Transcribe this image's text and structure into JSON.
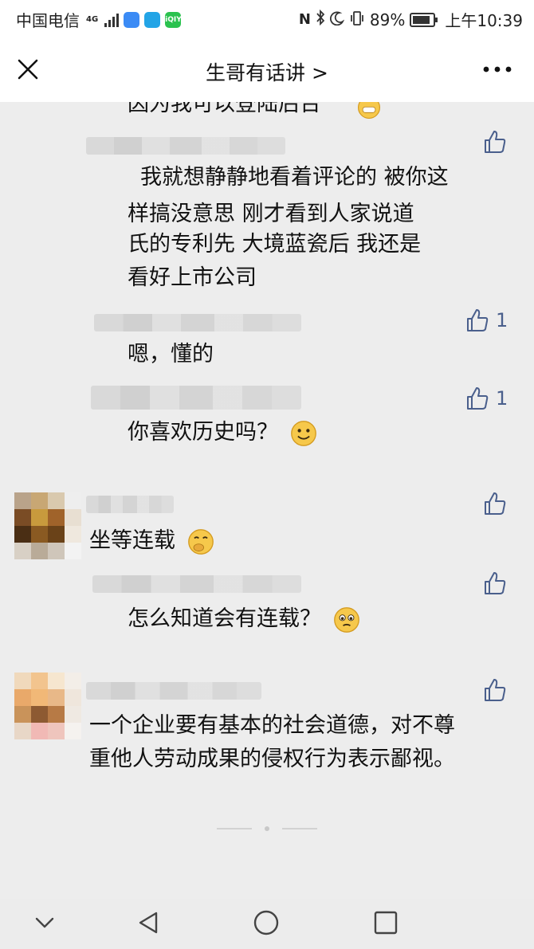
{
  "status_bar": {
    "carrier": "中国电信",
    "network": "4G",
    "battery": "89%",
    "time": "上午10:39"
  },
  "header": {
    "title": "生哥有话讲 >"
  },
  "comments": {
    "partial_top": "因为我可以登陆后台",
    "c1": "我就想静静地看着评论的   被你这",
    "c1_line2": "样搞没意思        刚才看到人家说道",
    "c1_line3": "氏的专利先  大境蓝瓷后    我还是",
    "c1_line4": "看好上市公司",
    "c2": "嗯，懂的",
    "c2_likes": "1",
    "c3": "你喜欢历史吗？",
    "c3_likes": "1",
    "c4": "坐等连载",
    "c5": "怎么知道会有连载？",
    "c6_line1": "一个企业要有基本的社会道德，对不尊",
    "c6_line2": "重他人劳动成果的侵权行为表示鄙视。"
  },
  "icons": {
    "like": "thumbs-up-icon",
    "close": "close-icon",
    "more": "more-icon"
  },
  "colors": {
    "accent": "#4a5f8c",
    "background": "#ededed"
  }
}
